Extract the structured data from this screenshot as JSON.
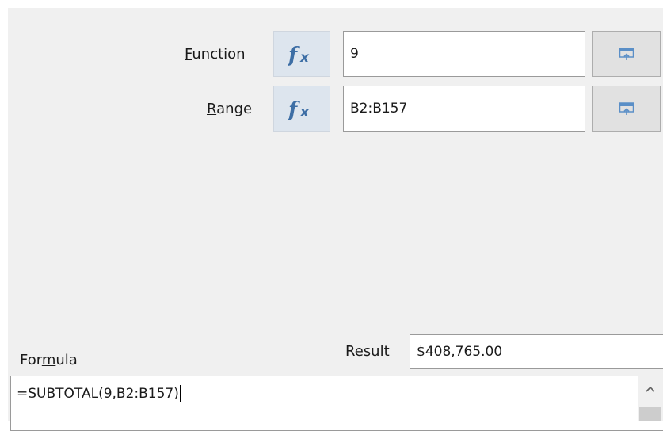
{
  "arguments": [
    {
      "label_accel": "F",
      "label_rest": "unction",
      "fx_icon": "function-wizard-icon",
      "value": "9",
      "shrink_icon": "shrink-dialog-icon"
    },
    {
      "label_accel": "R",
      "label_rest": "ange",
      "fx_icon": "function-wizard-icon",
      "value": "B2:B157",
      "shrink_icon": "shrink-dialog-icon"
    }
  ],
  "formula": {
    "label_pre": "For",
    "label_accel": "m",
    "label_post": "ula",
    "value": "=SUBTOTAL(9,B2:B157)"
  },
  "result": {
    "label_accel": "R",
    "label_rest": "esult",
    "value": "$408,765.00"
  },
  "scrollbar": {
    "up_icon": "chevron-up-icon"
  },
  "colors": {
    "panel_bg": "#f0f0f0",
    "fx_button_bg": "#dde5ee",
    "fx_icon": "#3d6ea5",
    "shrink_icon": "#5b8fc7"
  }
}
